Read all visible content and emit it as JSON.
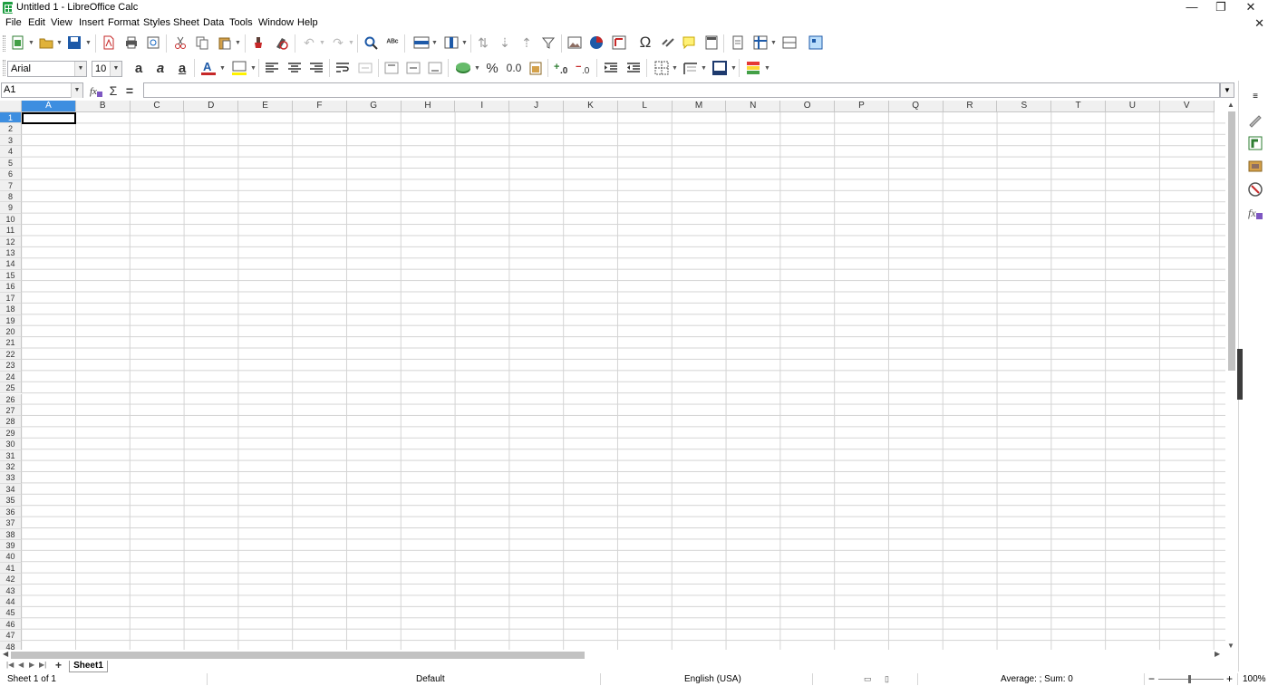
{
  "window": {
    "title": "Untitled 1 - LibreOffice Calc",
    "minimize": "—",
    "restore": "❐",
    "close": "✕",
    "doc_close": "✕"
  },
  "menu": [
    "File",
    "Edit",
    "View",
    "Insert",
    "Format",
    "Styles",
    "Sheet",
    "Data",
    "Tools",
    "Window",
    "Help"
  ],
  "toolbar2": {
    "font_name": "Arial",
    "font_size": "10",
    "number_format_decimal": "0.0",
    "percent": "%"
  },
  "formula_bar": {
    "name_box": "A1",
    "input_value": ""
  },
  "grid": {
    "columns": [
      "A",
      "B",
      "C",
      "D",
      "E",
      "F",
      "G",
      "H",
      "I",
      "J",
      "K",
      "L",
      "M",
      "N",
      "O",
      "P",
      "Q",
      "R",
      "S",
      "T",
      "U",
      "V"
    ],
    "row_count": 48,
    "selected_cell": "A1"
  },
  "sheets": {
    "tabs": [
      "Sheet1"
    ],
    "active": "Sheet1"
  },
  "status": {
    "sheet_pos": "Sheet 1 of 1",
    "page_style": "Default",
    "language": "English (USA)",
    "selection_stats": "Average: ; Sum: 0",
    "zoom": "100%",
    "zoom_minus": "−",
    "zoom_plus": "+"
  },
  "colors": {
    "selection_blue": "#3d8ee0",
    "calc_green": "#1e9e41"
  }
}
